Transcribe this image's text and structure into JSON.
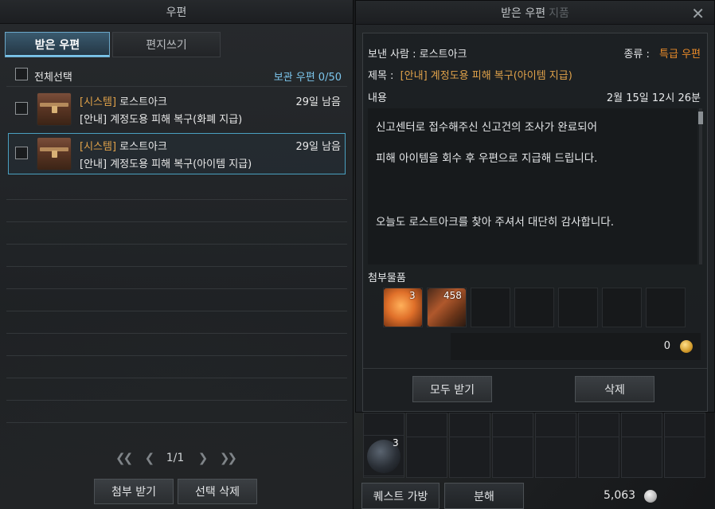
{
  "mailbox": {
    "title": "우편",
    "tabs": [
      {
        "label": "받은 우편",
        "active": true
      },
      {
        "label": "편지쓰기",
        "active": false
      }
    ],
    "select_all_label": "전체선택",
    "storage_label": "보관 우편 0/50",
    "mails": [
      {
        "tag": "[시스템]",
        "sender": "로스트아크",
        "days_left": "29일 남음",
        "subject": "[안내] 계정도용 피해 복구(화폐 지급)",
        "selected": false
      },
      {
        "tag": "[시스템]",
        "sender": "로스트아크",
        "days_left": "29일 남음",
        "subject": "[안내] 계정도용 피해 복구(아이템 지급)",
        "selected": true
      }
    ],
    "pagination": {
      "current": "1/1"
    },
    "buttons": {
      "receive_attachments": "첨부 받기",
      "delete_selected": "선택 삭제"
    }
  },
  "mail_view": {
    "title": "받은 우편",
    "title_suffix": "지품",
    "sender_label": "보낸 사람 : 로스트아크",
    "type_label": "종류 :",
    "type_value": "특급 우편",
    "subject_label": "제목 :",
    "subject_value": "[안내] 계정도용 피해 복구(아이템 지급)",
    "content_label": "내용",
    "date": "2월 15일 12시 26분",
    "content_lines": [
      "신고센터로 접수해주신 신고건의 조사가 완료되어",
      "피해 아이템을 회수 후 우편으로 지급해 드립니다.",
      "오늘도 로스트아크를 찾아 주셔서 대단히 감사합니다."
    ],
    "attachments_label": "첨부물품",
    "attachments": [
      {
        "icon": "orange-capsule-icon",
        "count": "3"
      },
      {
        "icon": "crossed-tools-icon",
        "count": "458"
      }
    ],
    "gold_amount": "0",
    "buttons": {
      "receive_all": "모두 받기",
      "delete": "삭제"
    }
  },
  "inventory": {
    "bag_count": "3",
    "quest_bag_label": "퀘스트 가방",
    "dismantle_label": "분해",
    "silver_amount": "5,063"
  },
  "colors": {
    "accent_blue": "#4aa0c0",
    "system_tag": "#e0a24a",
    "express_mail": "#e88a2a"
  }
}
